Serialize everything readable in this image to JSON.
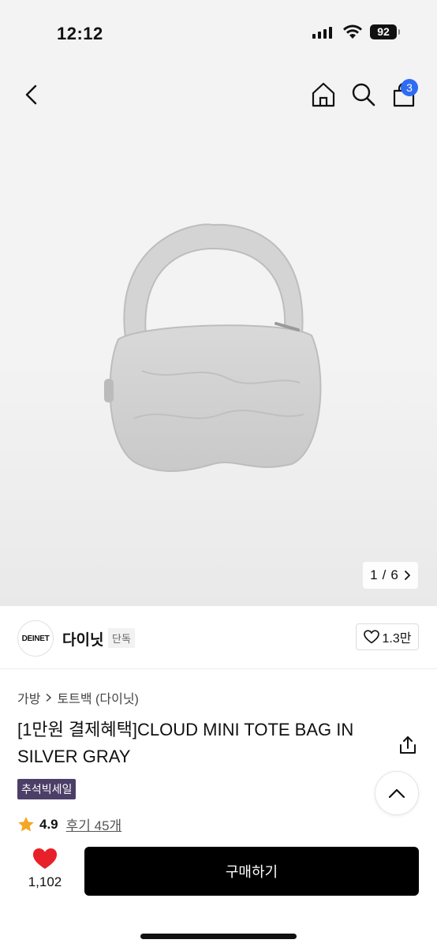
{
  "status": {
    "time": "12:12",
    "battery": "92"
  },
  "nav": {
    "cart_count": "3"
  },
  "gallery": {
    "current": "1",
    "separator": "/",
    "total": "6",
    "next_icon": "chevron-right-icon"
  },
  "brand": {
    "logo_text": "DEINET",
    "name": "다이닛",
    "tag": "단독",
    "likes": "1.3만"
  },
  "breadcrumb": {
    "category": "가방",
    "subcategory": "토트백 (다이닛)"
  },
  "product": {
    "title": "[1만원 결제혜택]CLOUD MINI TOTE BAG IN SILVER GRAY",
    "sale_tag": "추석빅세일",
    "rating": "4.9",
    "reviews": "후기 45개"
  },
  "bottom": {
    "wish_count": "1,102",
    "buy_label": "구매하기"
  },
  "colors": {
    "badge": "#2f6cf3",
    "sale_tag": "#4b3f67",
    "heart": "#e8202a",
    "star": "#f5a623",
    "buy": "#000000"
  }
}
